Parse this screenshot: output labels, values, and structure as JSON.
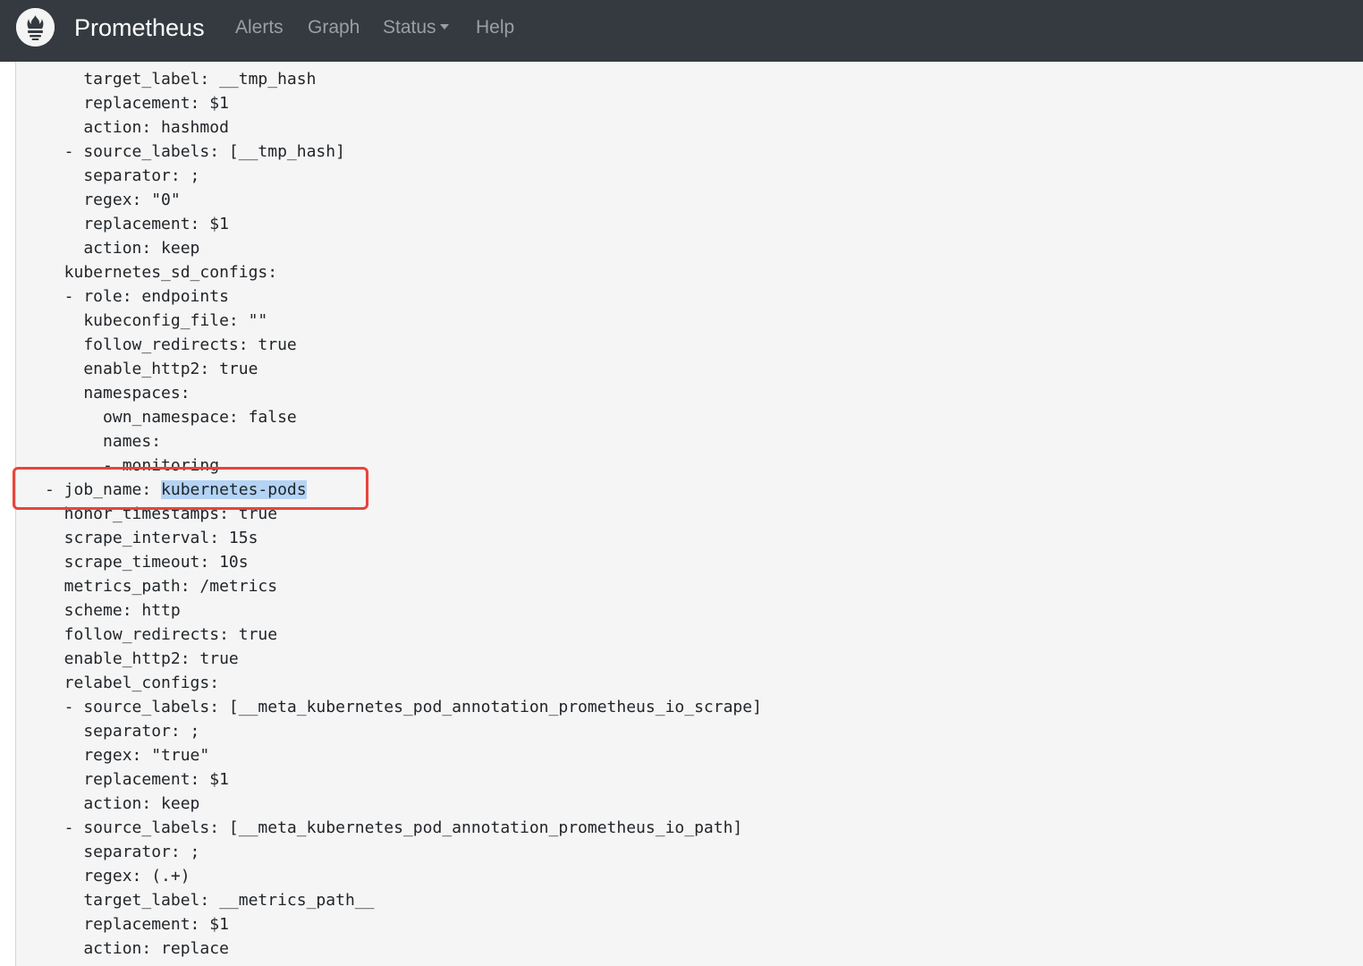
{
  "navbar": {
    "brand": "Prometheus",
    "links": [
      {
        "label": "Alerts"
      },
      {
        "label": "Graph"
      },
      {
        "label": "Status"
      },
      {
        "label": "Help"
      }
    ]
  },
  "config_lines": [
    "    target_label: __tmp_hash",
    "    replacement: $1",
    "    action: hashmod",
    "  - source_labels: [__tmp_hash]",
    "    separator: ;",
    "    regex: \"0\"",
    "    replacement: $1",
    "    action: keep",
    "  kubernetes_sd_configs:",
    "  - role: endpoints",
    "    kubeconfig_file: \"\"",
    "    follow_redirects: true",
    "    enable_http2: true",
    "    namespaces:",
    "      own_namespace: false",
    "      names:",
    "      - monitoring",
    "- job_name: ",
    "  honor_timestamps: true",
    "  scrape_interval: 15s",
    "  scrape_timeout: 10s",
    "  metrics_path: /metrics",
    "  scheme: http",
    "  follow_redirects: true",
    "  enable_http2: true",
    "  relabel_configs:",
    "  - source_labels: [__meta_kubernetes_pod_annotation_prometheus_io_scrape]",
    "    separator: ;",
    "    regex: \"true\"",
    "    replacement: $1",
    "    action: keep",
    "  - source_labels: [__meta_kubernetes_pod_annotation_prometheus_io_path]",
    "    separator: ;",
    "    regex: (.+)",
    "    target_label: __metrics_path__",
    "    replacement: $1",
    "    action: replace"
  ],
  "selected_text": "kubernetes-pods",
  "colors": {
    "navbar_bg": "#343a40",
    "code_bg": "#f5f5f5",
    "selection": "#b4d3f5",
    "highlight_box": "#e8443a"
  }
}
